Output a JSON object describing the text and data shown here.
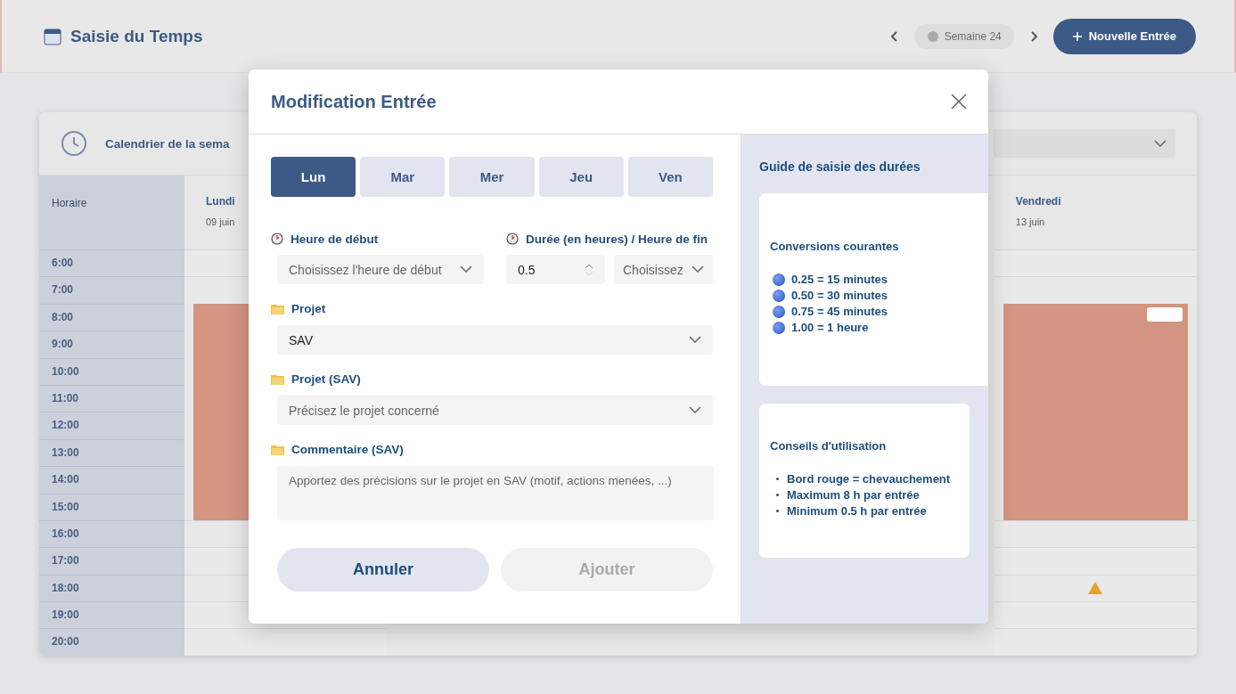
{
  "app_header": {
    "title": "Saisie du Temps",
    "week": "Semaine 24",
    "new_button": "Nouvelle Entrée"
  },
  "calendar": {
    "title": "Calendrier de la sema",
    "time_header": "Horaire",
    "first_day": {
      "name": "Lundi",
      "date": "09 juin",
      "has_entry": true
    },
    "last_day": {
      "name": "Vendredi",
      "date": "13 juin",
      "has_entry": true,
      "warning": true
    },
    "times": [
      "6:00",
      "7:00",
      "8:00",
      "9:00",
      "10:00",
      "11:00",
      "12:00",
      "13:00",
      "14:00",
      "15:00",
      "16:00",
      "17:00",
      "18:00",
      "19:00",
      "20:00"
    ]
  },
  "modal": {
    "title": "Modification Entrée",
    "days": [
      {
        "label": "Lun",
        "selected": true
      },
      {
        "label": "Mar",
        "selected": false
      },
      {
        "label": "Mer",
        "selected": false
      },
      {
        "label": "Jeu",
        "selected": false
      },
      {
        "label": "Ven",
        "selected": false
      }
    ],
    "start": {
      "label": "Heure de début",
      "placeholder": "Choisissez l'heure de début"
    },
    "duration": {
      "label": "Durée (en heures) / Heure de fin",
      "value": "0.5",
      "end_placeholder": "Choisissez"
    },
    "project": {
      "label": "Projet",
      "value": "SAV"
    },
    "sub_project": {
      "label": "Projet (SAV)",
      "placeholder": "Précisez le projet concerné"
    },
    "comment": {
      "label": "Commentaire (SAV)",
      "placeholder": "Apportez des précisions sur le projet en SAV (motif, actions menées, ...)"
    },
    "buttons": [
      {
        "label": "Annuler",
        "disabled": false
      },
      {
        "label": "Ajouter",
        "disabled": true
      }
    ]
  },
  "guide": {
    "title": "Guide de saisie des durées",
    "cards": [
      {
        "title": "Conversions courantes",
        "kind": "dots",
        "items": [
          "0.25 = 15 minutes",
          "0.50 = 30 minutes",
          "0.75 = 45 minutes",
          "1.00 = 1 heure"
        ]
      },
      {
        "title": "Conseils d'utilisation",
        "kind": "bullets",
        "items": [
          "Bord rouge = chevauchement",
          "Maximum 8 h par entrée",
          "Minimum 0.5 h par entrée"
        ]
      }
    ]
  }
}
